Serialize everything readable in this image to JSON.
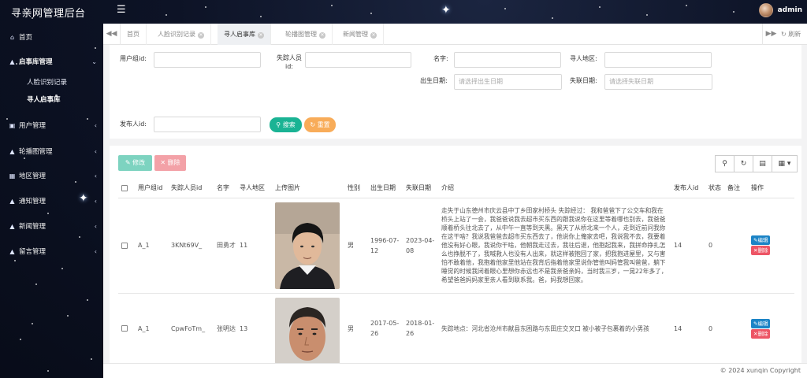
{
  "app": {
    "title": "寻亲网管理后台",
    "user": "admin"
  },
  "icons": {
    "menu": "hamburger-icon",
    "refresh": "refresh-icon",
    "search": "search-icon"
  },
  "sidebar": {
    "items": [
      {
        "label": "首页",
        "icon": "home-icon"
      },
      {
        "label": "启事库管理",
        "icon": "bell-icon",
        "expanded": true
      },
      {
        "label": "用户管理",
        "icon": "user-icon"
      },
      {
        "label": "轮播图管理",
        "icon": "bell-icon"
      },
      {
        "label": "地区管理",
        "icon": "grid-icon"
      },
      {
        "label": "通知管理",
        "icon": "bell-icon"
      },
      {
        "label": "新闻管理",
        "icon": "bell-icon"
      },
      {
        "label": "留言管理",
        "icon": "bell-icon"
      }
    ],
    "subitems": [
      {
        "label": "人脸识别记录"
      },
      {
        "label": "寻人启事库",
        "active": true
      }
    ]
  },
  "tabs": [
    {
      "label": "首页",
      "closable": false
    },
    {
      "label": "人脸识别记录",
      "closable": true
    },
    {
      "label": "寻人启事库",
      "closable": true,
      "active": true
    },
    {
      "label": "轮播图管理",
      "closable": true
    },
    {
      "label": "新闻管理",
      "closable": true
    }
  ],
  "tab_refresh_label": "刷新",
  "search": {
    "userGroupId_label": "用户组id:",
    "missingPersonId_label": "失踪人员id:",
    "name_label": "名字:",
    "area_label": "寻人地区:",
    "birthDate_label": "出生日期:",
    "birthDate_placeholder": "请选择出生日期",
    "missingDate_label": "失联日期:",
    "missingDate_placeholder": "请选择失联日期",
    "publisherId_label": "发布人id:",
    "search_button": "搜索",
    "reset_button": "重置"
  },
  "toolbar": {
    "edit": "修改",
    "delete": "删除"
  },
  "table": {
    "columns": [
      "用户组id",
      "失踪人员id",
      "名字",
      "寻人地区",
      "上传图片",
      "性别",
      "出生日期",
      "失联日期",
      "介绍",
      "发布人id",
      "状态",
      "备注",
      "操作"
    ],
    "rows": [
      {
        "userGroupId": "A_1",
        "missingPersonId": "3KNt69V_",
        "name": "田勇才",
        "area": "11",
        "gender": "男",
        "birthDate": "1996-07-12",
        "missingDate": "2023-04-08",
        "intro": "走失于山东德州市庆云县中丁乡田家村桥头 失踪经过： 我和爸爸下了公交车和我在桥头上站了一会，我爸爸说我去超市买东西的跟我说你在这里等着哪也别去，我爸爸顺着桥头往北去了，从中午一直等到天黑。黑天了从桥北来一个人，走到近前问我你在这干啥？我说我爸爸去超市买东西去了，他说你上俺家去吧，我说我不去，我要着他没有好心眼，我说你干啥，他朝我走过去，我往后退，他抱起我来，我拼命挣扎怎么也挣脱不了，我喊救人也没有人出来，就这样被抱回了家，把我抱进屋里，又与害怕不敢着他，我抱着他家里他站在我背后指着他家里说你管他叫妈管我叫爸爸，躺下睡觉的时候我闭着眼心里想你赤远也不是我亲爸亲妈，当时我三岁，一晃22年多了，希望爸爸妈妈家里亲人看到联系我。爸，妈我想回家。",
        "publisherId": "14",
        "status": "0",
        "remark": "",
        "edit": "编辑",
        "delete": "删除"
      },
      {
        "userGroupId": "A_1",
        "missingPersonId": "CpwFoTm_",
        "name": "张明达",
        "area": "13",
        "gender": "男",
        "birthDate": "2017-05-26",
        "missingDate": "2018-01-26",
        "intro": "失踪地点：河北省沧州市献县东困路与东田庄交叉口 被小被子包裹着的小男孩",
        "publisherId": "14",
        "status": "0",
        "remark": "",
        "edit": "编辑",
        "delete": "删除"
      }
    ]
  },
  "footer": "© 2024 xunqin Copyright"
}
